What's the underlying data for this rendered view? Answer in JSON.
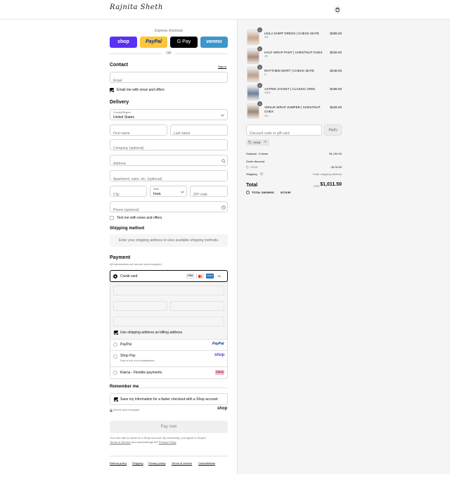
{
  "header": {
    "logo_text": "Rajnita Sheth",
    "cart_icon": "shopping-bag-icon"
  },
  "express": {
    "label": "Express checkout",
    "shop": "shop",
    "paypal": "PayPal",
    "gpay": "G Pay",
    "venmo": "venmo",
    "or": "OR"
  },
  "contact": {
    "title": "Contact",
    "sign_in": "Sign in",
    "email_placeholder": "Email",
    "news_label": "Email me with news and offers",
    "news_checked": true
  },
  "delivery": {
    "title": "Delivery",
    "country_label": "Country/Region",
    "country_value": "United States",
    "first_placeholder": "First name",
    "last_placeholder": "Last name",
    "company_placeholder": "Company (optional)",
    "address_placeholder": "Address",
    "apt_placeholder": "Apartment, suite, etc. (optional)",
    "city_placeholder": "City",
    "state_label": "State",
    "state_value": "Iowa",
    "zip_placeholder": "ZIP code",
    "phone_placeholder": "Phone (optional)",
    "text_label": "Text me with news and offers",
    "text_checked": false
  },
  "shipping": {
    "title": "Shipping method",
    "note": "Enter your shipping address to view available shipping methods."
  },
  "payment": {
    "title": "Payment",
    "subtitle": "All transactions are secure and encrypted.",
    "credit_card": "Credit card",
    "cards": [
      "VISA",
      "MC",
      "AMEX"
    ],
    "more": "+5",
    "billing_label": "Use shipping address as billing address",
    "paypal": "PayPal",
    "paypal_logo": "PayPal",
    "shop_pay": "Shop Pay",
    "shop_pay_sub": "Pay in full or in installments",
    "shop_logo": "shop",
    "klarna": "Klarna - Flexible payments",
    "klarna_logo": "Klarna"
  },
  "remember": {
    "title": "Remember me",
    "save_label": "Save my information for a faster checkout with a Shop account",
    "secure": "Secure and encrypted",
    "shop_logo": "shop"
  },
  "pay_button": "Pay now",
  "legal": {
    "prefix": "Your info will be saved to a Shop account. By continuing, you agree to Shop's",
    "terms": "Terms of Service",
    "middle": "and acknowledge the",
    "privacy": "Privacy Policy",
    "end": "."
  },
  "footer_links": [
    "Refund policy",
    "Shipping",
    "Privacy policy",
    "Terms of service",
    "Cancellations"
  ],
  "cart": {
    "items": [
      {
        "name": "LEILA SHIRT DRESS | CHECK MATE",
        "variant": "XS",
        "price": "$288.00",
        "qty": "1",
        "color": "#c9a58e"
      },
      {
        "name": "HALF WRAP PANT | CHESTNUT CHEX",
        "variant": "XS",
        "price": "$228.00",
        "qty": "1",
        "color": "#a98b78"
      },
      {
        "name": "RHYTHEM SKIRT | CHECK MATE",
        "variant": "S",
        "price": "$248.00",
        "qty": "1",
        "color": "#bfa08c"
      },
      {
        "name": "ASTRID JACKET | CLASSIC GRID",
        "variant": "XS/S",
        "price": "$198.00",
        "qty": "1",
        "color": "#6e7f99"
      },
      {
        "name": "VENUS WRAP JUMPER | CHESTNUT CHEX",
        "variant": "XS",
        "price": "$228.00",
        "qty": "1",
        "color": "#9f8674"
      }
    ],
    "discount_placeholder": "Discount code or gift card",
    "apply": "Apply",
    "code_tag": "VG15",
    "subtotal_label": "Subtotal · 5 items",
    "subtotal_value": "$1,190.00",
    "order_discount_label": "Order discount",
    "order_discount_code": "VG15",
    "order_discount_value": "- $178.50",
    "shipping_label": "Shipping",
    "shipping_value": "Enter shipping address",
    "total_label": "Total",
    "currency": "USD",
    "total_value": "$1,011.50",
    "savings_label": "TOTAL SAVINGS",
    "savings_value": "$178.50"
  }
}
